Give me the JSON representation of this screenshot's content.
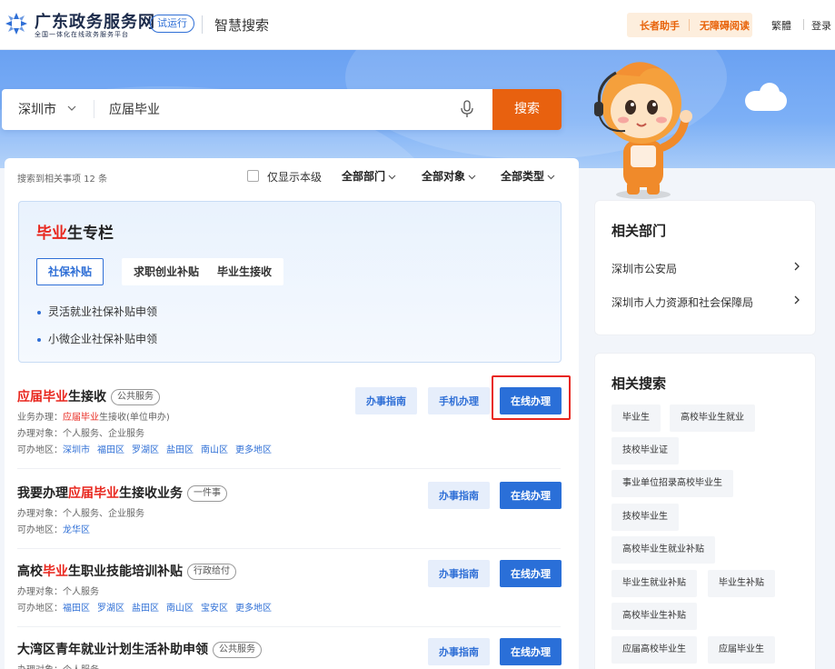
{
  "header": {
    "logo_title": "广东政务服务网",
    "logo_subtitle": "全国一体化在线政务服务平台",
    "trial_badge": "试运行",
    "section_title": "智慧搜索",
    "elder_helper": "长者助手",
    "accessible_reading": "无障碍阅读",
    "traditional": "繁體",
    "login": "登录"
  },
  "search": {
    "city": "深圳市",
    "query": "应届毕业",
    "button": "搜索"
  },
  "filters": {
    "result_count": "搜索到相关事项 12 条",
    "only_this_level": "仅显示本级",
    "department": "全部部门",
    "target": "全部对象",
    "type": "全部类型"
  },
  "graduate_panel": {
    "title_hl": "毕业",
    "title_rest": "生专栏",
    "tabs": [
      "社保补贴",
      "求职创业补贴",
      "毕业生接收"
    ],
    "links": [
      "灵活就业社保补贴申领",
      "小微企业社保补贴申领"
    ]
  },
  "results": [
    {
      "title_hl": "应届毕业",
      "title_rest": "生接收",
      "tag": "公共服务",
      "business_label": "业务办理：",
      "business_hl": "应届毕业",
      "business_rest": "生接收(单位申办)",
      "target": "办理对象：个人服务、企业服务",
      "area_label": "可办地区：",
      "areas": [
        "深圳市",
        "福田区",
        "罗湖区",
        "盐田区",
        "南山区",
        "更多地区"
      ],
      "guide": "办事指南",
      "mobile": "手机办理",
      "online": "在线办理"
    },
    {
      "title_prefix": "我要办理",
      "title_hl": "应届毕业",
      "title_rest": "生接收业务",
      "tag": "一件事",
      "target": "办理对象：个人服务、企业服务",
      "area_label": "可办地区：",
      "areas": [
        "龙华区"
      ],
      "guide": "办事指南",
      "online": "在线办理"
    },
    {
      "title_prefix": "高校",
      "title_hl": "毕业",
      "title_rest": "生职业技能培训补贴",
      "tag": "行政给付",
      "target": "办理对象：个人服务",
      "area_label": "可办地区：",
      "areas": [
        "福田区",
        "罗湖区",
        "盐田区",
        "南山区",
        "宝安区",
        "更多地区"
      ],
      "guide": "办事指南",
      "online": "在线办理"
    },
    {
      "title_prefix": "大湾区青年就业计划生活补助申领",
      "tag": "公共服务",
      "target": "办理对象：个人服务",
      "guide": "办事指南",
      "online": "在线办理"
    }
  ],
  "side": {
    "dept_title": "相关部门",
    "departments": [
      "深圳市公安局",
      "深圳市人力资源和社会保障局"
    ],
    "related_title": "相关搜索",
    "related": [
      "毕业生",
      "高校毕业生就业",
      "技校毕业证",
      "事业单位招录高校毕业生",
      "技校毕业生",
      "高校毕业生就业补贴",
      "毕业生就业补贴",
      "毕业生补贴",
      "高校毕业生补贴",
      "应届高校毕业生",
      "应届毕业生"
    ]
  },
  "colors": {
    "accent_blue": "#2a6fd8",
    "search_orange": "#e8610f",
    "highlight_red": "#e8261d"
  }
}
